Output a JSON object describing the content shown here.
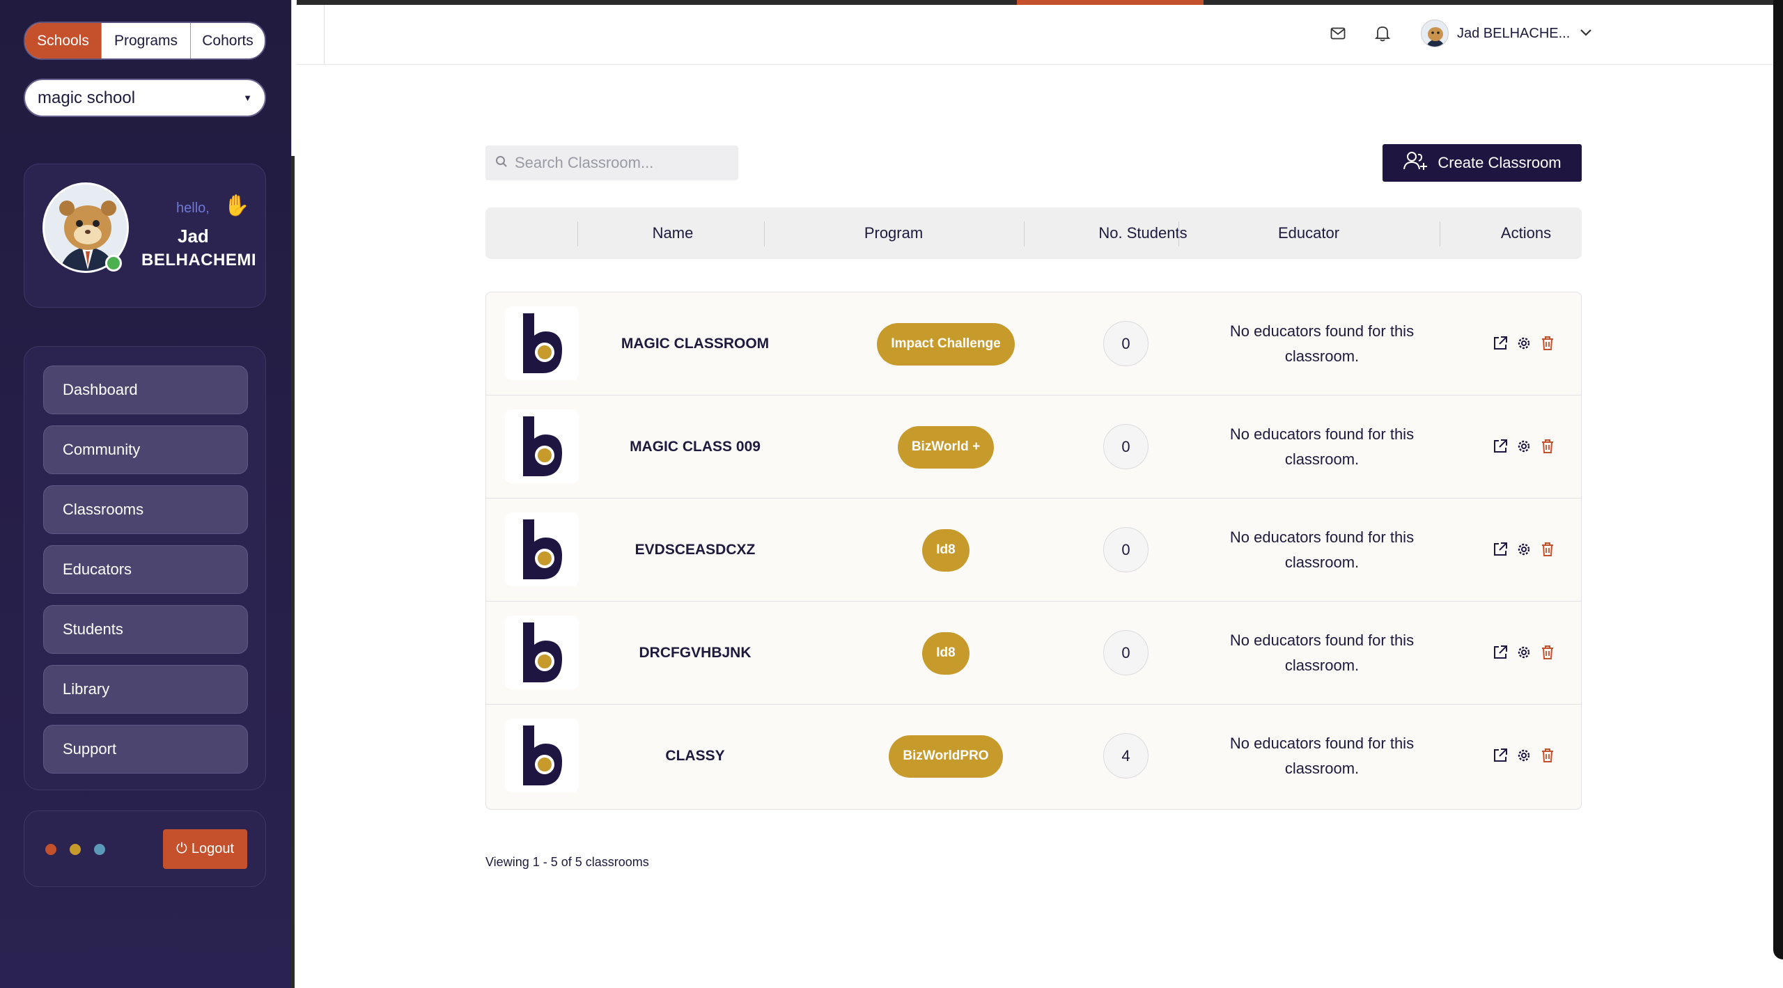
{
  "tabs": [
    {
      "label": "Schools",
      "active": true
    },
    {
      "label": "Programs",
      "active": false
    },
    {
      "label": "Cohorts",
      "active": false
    }
  ],
  "school_select": {
    "value": "magic school"
  },
  "profile": {
    "greeting": "hello,",
    "first_name": "Jad",
    "last_name": "BELHACHEMI"
  },
  "nav": {
    "items": [
      "Dashboard",
      "Community",
      "Classrooms",
      "Educators",
      "Students",
      "Library",
      "Support"
    ]
  },
  "logout": {
    "label": "Logout"
  },
  "theme_dots": [
    "#c5502c",
    "#c79a2c",
    "#5b9ab8"
  ],
  "topbar": {
    "user_name": "Jad BELHACHE..."
  },
  "search": {
    "placeholder": "Search Classroom..."
  },
  "create_button": {
    "label": "Create Classroom"
  },
  "table": {
    "columns": [
      "Name",
      "Program",
      "No. Students",
      "Educator",
      "Actions"
    ],
    "rows": [
      {
        "name": "MAGIC CLASSROOM",
        "program": "Impact Challenge",
        "students": "0",
        "educator": "No educators found for this classroom."
      },
      {
        "name": "MAGIC CLASS 009",
        "program": "BizWorld +",
        "students": "0",
        "educator": "No educators found for this classroom."
      },
      {
        "name": "EVDSCEASDCXZ",
        "program": "Id8",
        "students": "0",
        "educator": "No educators found for this classroom."
      },
      {
        "name": "DRCFGVHBJNK",
        "program": "Id8",
        "students": "0",
        "educator": "No educators found for this classroom."
      },
      {
        "name": "CLASSY",
        "program": "BizWorldPRO",
        "students": "4",
        "educator": "No educators found for this classroom."
      }
    ]
  },
  "footer": {
    "viewing": "Viewing 1 - 5 of 5 classrooms"
  },
  "colors": {
    "accent": "#c5502c",
    "brand_dark": "#1e1640",
    "pill": "#c79a2c",
    "sidebar": "#211b3f"
  }
}
